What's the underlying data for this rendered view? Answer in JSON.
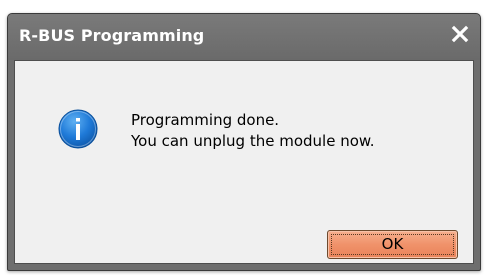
{
  "window": {
    "title": "R-BUS Programming",
    "close_icon": "close-icon"
  },
  "message": {
    "icon": "info-icon",
    "line1": "Programming done.",
    "line2": "You can unplug the module now."
  },
  "buttons": {
    "ok_label": "OK"
  },
  "colors": {
    "titlebar": "#6e6e6e",
    "client_background": "#f0f0f0",
    "info_icon": "#1a74d4",
    "ok_button": "#f0926a"
  }
}
